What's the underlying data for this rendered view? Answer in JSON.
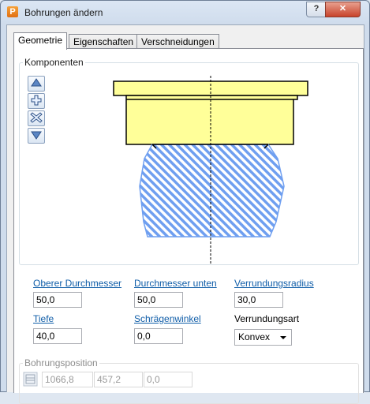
{
  "window": {
    "title": "Bohrungen ändern",
    "app_icon_letter": "P",
    "help_label": "?",
    "close_label": "✕"
  },
  "tabs": [
    {
      "label": "Geometrie",
      "active": true
    },
    {
      "label": "Eigenschaften",
      "active": false
    },
    {
      "label": "Verschneidungen",
      "active": false
    }
  ],
  "components": {
    "label": "Komponenten",
    "buttons": [
      "move-up-icon",
      "add-icon",
      "delete-icon",
      "move-down-icon"
    ],
    "colors": {
      "cylinder_fill": "#ffff99",
      "hatch_fill": "#6f9ff0",
      "outline": "#000000"
    }
  },
  "fields": {
    "upper_diameter": {
      "label": "Oberer Durchmesser",
      "value": "50,0"
    },
    "lower_diameter": {
      "label": "Durchmesser unten",
      "value": "50,0"
    },
    "round_radius": {
      "label": "Verrundungsradius",
      "value": "30,0"
    },
    "depth": {
      "label": "Tiefe",
      "value": "40,0"
    },
    "draft_angle": {
      "label": "Schrägenwinkel",
      "value": "0,0"
    },
    "round_type": {
      "label": "Verrundungsart",
      "value": "Konvex"
    }
  },
  "position": {
    "label": "Bohrungsposition",
    "x": "1066,8",
    "y": "457,2",
    "z": "0,0"
  }
}
